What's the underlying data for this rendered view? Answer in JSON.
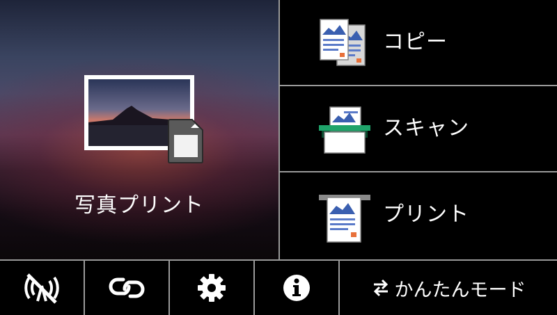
{
  "photo_print": {
    "label": "写真プリント",
    "icon": "photo-icon",
    "card_icon": "sd-card-icon"
  },
  "menu": [
    {
      "id": "copy",
      "label": "コピー",
      "icon": "copy-icon"
    },
    {
      "id": "scan",
      "label": "スキャン",
      "icon": "scan-icon"
    },
    {
      "id": "print",
      "label": "プリント",
      "icon": "print-icon"
    }
  ],
  "bottom": {
    "wifi_icon": "wifi-off-icon",
    "connect_icon": "link-icon",
    "settings_icon": "gear-icon",
    "info_icon": "info-icon",
    "easy_mode_icon": "swap-arrows-icon",
    "easy_mode_label": "かんたんモード"
  },
  "colors": {
    "background": "#000000",
    "divider": "#9a9a9a",
    "scan_accent": "#1fa36a",
    "doc_accent": "#e8713a"
  }
}
